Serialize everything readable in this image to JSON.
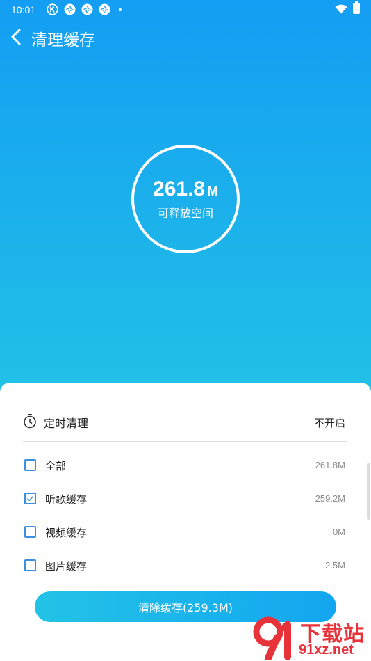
{
  "status_bar": {
    "time": "10:01",
    "notification_icons": [
      "k-circle-icon",
      "aperture-icon",
      "aperture-icon",
      "aperture-icon"
    ],
    "wifi_icon": "wifi-icon",
    "battery_icon": "battery-charging-icon"
  },
  "header": {
    "back_icon": "chevron-left-icon",
    "title": "清理缓存"
  },
  "summary": {
    "value": "261.8",
    "unit": "M",
    "label": "可释放空间"
  },
  "timer": {
    "icon": "clock-icon",
    "label": "定时清理",
    "value": "不开启"
  },
  "items": [
    {
      "label": "全部",
      "size": "261.8M",
      "checked": false
    },
    {
      "label": "听歌缓存",
      "size": "259.2M",
      "checked": true
    },
    {
      "label": "视频缓存",
      "size": "0M",
      "checked": false
    },
    {
      "label": "图片缓存",
      "size": "2.5M",
      "checked": false
    }
  ],
  "action": {
    "clear_label": "清除缓存(259.3M)"
  },
  "watermark": {
    "title": "下载站",
    "url": "91xz.net"
  },
  "colors": {
    "accent": "#1aa7ef",
    "gradient_top": "#139ef3",
    "gradient_bottom": "#22c3e6",
    "checkbox": "#3a8fdf"
  }
}
